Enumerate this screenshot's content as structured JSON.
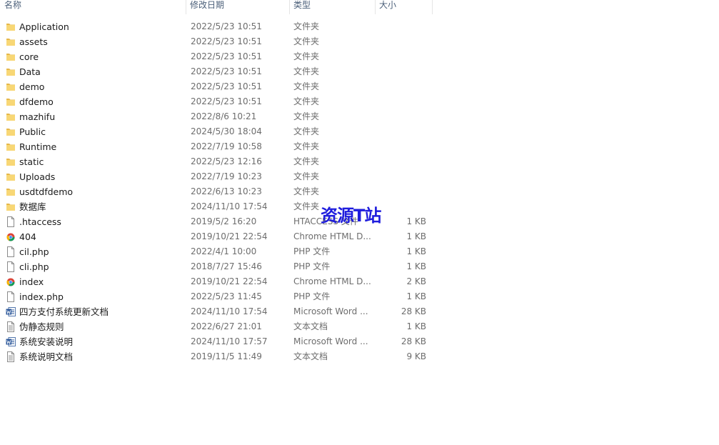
{
  "columns": {
    "name": "名称",
    "date": "修改日期",
    "type": "类型",
    "size": "大小"
  },
  "files": [
    {
      "name": "Application",
      "date": "2022/5/23 10:51",
      "type": "文件夹",
      "size": "",
      "icon": "folder-icon"
    },
    {
      "name": "assets",
      "date": "2022/5/23 10:51",
      "type": "文件夹",
      "size": "",
      "icon": "folder-icon"
    },
    {
      "name": "core",
      "date": "2022/5/23 10:51",
      "type": "文件夹",
      "size": "",
      "icon": "folder-icon"
    },
    {
      "name": "Data",
      "date": "2022/5/23 10:51",
      "type": "文件夹",
      "size": "",
      "icon": "folder-icon"
    },
    {
      "name": "demo",
      "date": "2022/5/23 10:51",
      "type": "文件夹",
      "size": "",
      "icon": "folder-icon"
    },
    {
      "name": "dfdemo",
      "date": "2022/5/23 10:51",
      "type": "文件夹",
      "size": "",
      "icon": "folder-icon"
    },
    {
      "name": "mazhifu",
      "date": "2022/8/6 10:21",
      "type": "文件夹",
      "size": "",
      "icon": "folder-icon"
    },
    {
      "name": "Public",
      "date": "2024/5/30 18:04",
      "type": "文件夹",
      "size": "",
      "icon": "folder-icon"
    },
    {
      "name": "Runtime",
      "date": "2022/7/19 10:58",
      "type": "文件夹",
      "size": "",
      "icon": "folder-icon"
    },
    {
      "name": "static",
      "date": "2022/5/23 12:16",
      "type": "文件夹",
      "size": "",
      "icon": "folder-icon"
    },
    {
      "name": "Uploads",
      "date": "2022/7/19 10:23",
      "type": "文件夹",
      "size": "",
      "icon": "folder-icon"
    },
    {
      "name": "usdtdfdemo",
      "date": "2022/6/13 10:23",
      "type": "文件夹",
      "size": "",
      "icon": "folder-icon"
    },
    {
      "name": "数据库",
      "date": "2024/11/10 17:54",
      "type": "文件夹",
      "size": "",
      "icon": "folder-icon"
    },
    {
      "name": ".htaccess",
      "date": "2019/5/2 16:20",
      "type": "HTACCESS 文件",
      "size": "1 KB",
      "icon": "file-icon"
    },
    {
      "name": "404",
      "date": "2019/10/21 22:54",
      "type": "Chrome HTML D...",
      "size": "1 KB",
      "icon": "chrome-icon"
    },
    {
      "name": "cil.php",
      "date": "2022/4/1 10:00",
      "type": "PHP 文件",
      "size": "1 KB",
      "icon": "file-icon"
    },
    {
      "name": "cli.php",
      "date": "2018/7/27 15:46",
      "type": "PHP 文件",
      "size": "1 KB",
      "icon": "file-icon"
    },
    {
      "name": "index",
      "date": "2019/10/21 22:54",
      "type": "Chrome HTML D...",
      "size": "2 KB",
      "icon": "chrome-icon"
    },
    {
      "name": "index.php",
      "date": "2022/5/23 11:45",
      "type": "PHP 文件",
      "size": "1 KB",
      "icon": "file-icon"
    },
    {
      "name": "四方支付系统更新文档",
      "date": "2024/11/10 17:54",
      "type": "Microsoft Word ...",
      "size": "28 KB",
      "icon": "word-icon"
    },
    {
      "name": "伪静态规则",
      "date": "2022/6/27 21:01",
      "type": "文本文档",
      "size": "1 KB",
      "icon": "text-file-icon"
    },
    {
      "name": "系统安装说明",
      "date": "2024/11/10 17:57",
      "type": "Microsoft Word ...",
      "size": "28 KB",
      "icon": "word-icon"
    },
    {
      "name": "系统说明文档",
      "date": "2019/11/5 11:49",
      "type": "文本文档",
      "size": "9 KB",
      "icon": "text-file-icon"
    }
  ],
  "watermark": "资源T站",
  "colors": {
    "folder": "#f8d775",
    "folder_dark": "#e6b84a",
    "word": "#2b579a",
    "watermark": "#1f1ddd"
  }
}
